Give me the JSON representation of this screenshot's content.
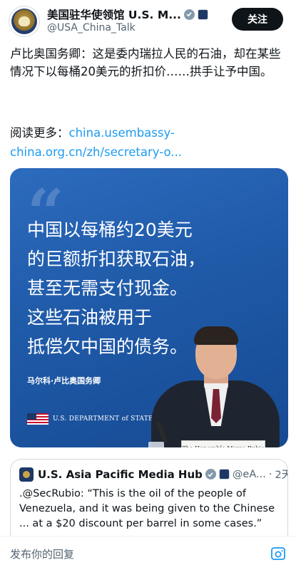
{
  "header": {
    "display_name": "美国驻华使领馆 U.S. M...",
    "handle": "@USA_China_Talk",
    "follow_label": "关注"
  },
  "tweet": {
    "text": "卢比奥国务卿：这是委内瑞拉人民的石油，却在某些情况下以每桶20美元的折扣价……拱手让予中国。",
    "read_more_label": "阅读更多：",
    "link_text": "china.usembassy-china.org.cn/zh/secretary-o..."
  },
  "media": {
    "quote_lines": [
      "中国以每桶约20美元",
      "的巨额折扣获取石油，",
      "甚至无需支付现金。",
      "这些石油被用于",
      "抵偿欠中国的债务。"
    ],
    "speaker": "马尔科·卢比奥国务卿",
    "department_text": "U.S. DEPARTMENT of STATE",
    "nameplate_text": "The Honorable Marco Rubio"
  },
  "quoted_tweet": {
    "name": "U.S. Asia Pacific Media Hub",
    "handle": "@eA...",
    "separator": "·",
    "time": "2天",
    "text": ".@SecRubio: “This is the oil of the people of Venezuela, and it was being given to the Chinese ... at a $20 discount per barrel in some cases.”"
  },
  "reply": {
    "placeholder": "发布你的回复"
  },
  "colors": {
    "link": "#1d9bf0",
    "follow_button": "#0f1419",
    "card_blue": "#1f5aa8"
  },
  "icons": [
    "embassy-seal-icon",
    "verified-badge-icon",
    "affiliate-badge-icon",
    "us-flag-icon",
    "add-media-icon"
  ]
}
